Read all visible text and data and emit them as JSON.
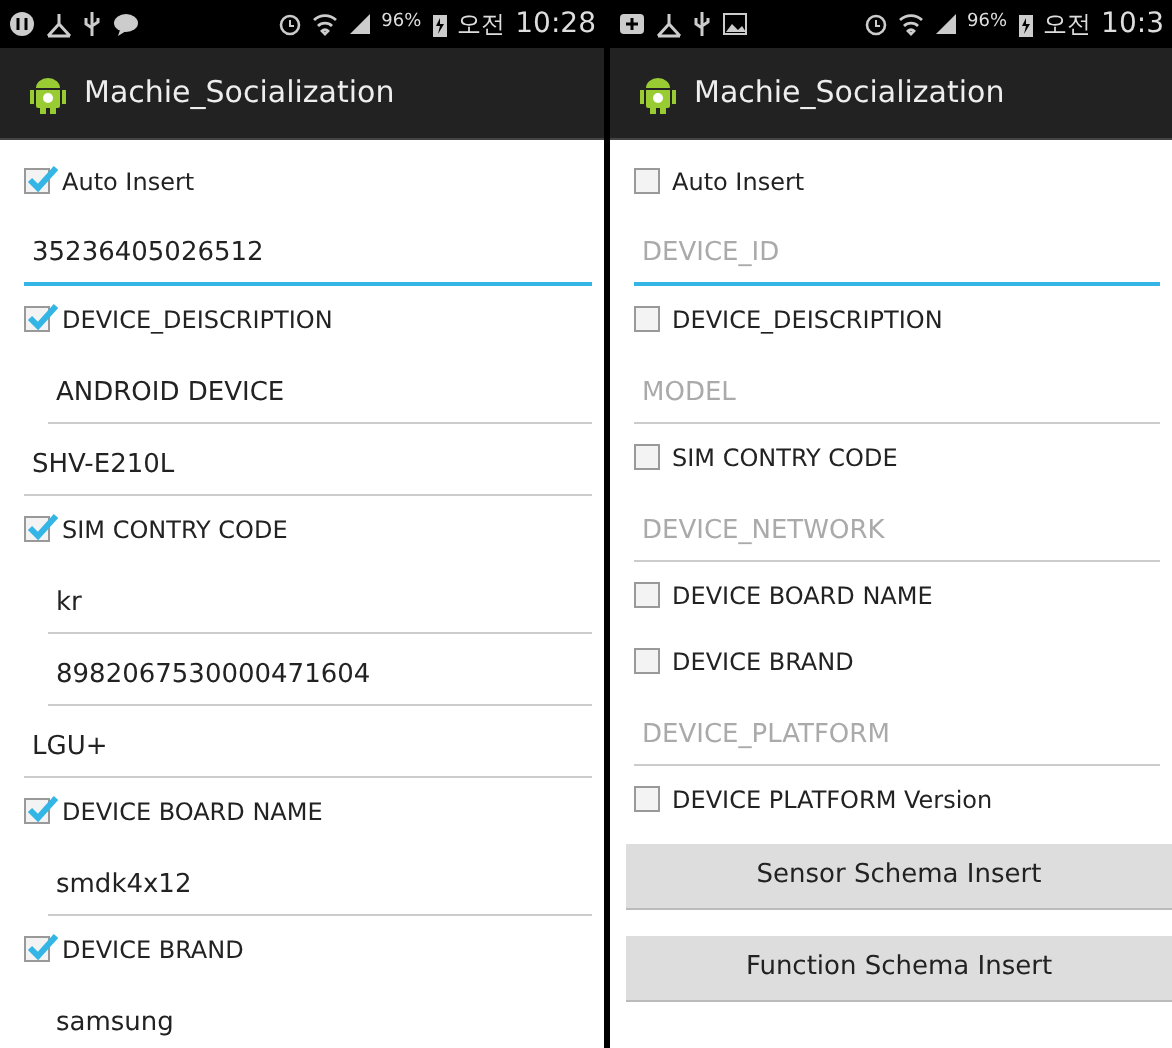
{
  "screens": [
    {
      "status_bar": {
        "battery": "96%",
        "ampm": "오전",
        "time": "10:28",
        "notifications": [
          {
            "kind": "logo"
          },
          {
            "kind": "hanger"
          },
          {
            "kind": "usb"
          },
          {
            "kind": "chat"
          }
        ]
      },
      "title": "Machie_Socialization",
      "items": [
        {
          "kind": "checkbox",
          "label": "Auto Insert",
          "checked": true
        },
        {
          "kind": "field",
          "value": "35236405026512",
          "focused": true,
          "indented": false
        },
        {
          "kind": "checkbox",
          "label": "DEVICE_DEISCRIPTION",
          "checked": true
        },
        {
          "kind": "field",
          "value": "ANDROID DEVICE",
          "focused": false,
          "indented": true
        },
        {
          "kind": "field",
          "value": "SHV-E210L",
          "focused": false,
          "indented": false
        },
        {
          "kind": "checkbox",
          "label": "SIM CONTRY CODE",
          "checked": true
        },
        {
          "kind": "field",
          "value": "kr",
          "focused": false,
          "indented": true
        },
        {
          "kind": "field",
          "value": "8982067530000471604",
          "focused": false,
          "indented": true
        },
        {
          "kind": "field",
          "value": "LGU+",
          "focused": false,
          "indented": false
        },
        {
          "kind": "checkbox",
          "label": "DEVICE BOARD NAME",
          "checked": true
        },
        {
          "kind": "field",
          "value": "smdk4x12",
          "focused": false,
          "indented": true
        },
        {
          "kind": "checkbox",
          "label": "DEVICE BRAND",
          "checked": true
        },
        {
          "kind": "field",
          "value": "samsung",
          "focused": false,
          "indented": true
        }
      ]
    },
    {
      "status_bar": {
        "battery": "96%",
        "ampm": "오전",
        "time": "10:3",
        "notifications": [
          {
            "kind": "badge"
          },
          {
            "kind": "hanger"
          },
          {
            "kind": "usb"
          },
          {
            "kind": "image"
          }
        ]
      },
      "title": "Machie_Socialization",
      "items": [
        {
          "kind": "checkbox",
          "label": "Auto Insert",
          "checked": false
        },
        {
          "kind": "field",
          "placeholder": "DEVICE_ID",
          "focused": true,
          "indented": false
        },
        {
          "kind": "checkbox",
          "label": "DEVICE_DEISCRIPTION",
          "checked": false
        },
        {
          "kind": "field",
          "placeholder": "MODEL",
          "focused": false,
          "indented": false
        },
        {
          "kind": "checkbox",
          "label": "SIM CONTRY CODE",
          "checked": false
        },
        {
          "kind": "field",
          "placeholder": "DEVICE_NETWORK",
          "focused": false,
          "indented": false
        },
        {
          "kind": "checkbox",
          "label": "DEVICE BOARD NAME",
          "checked": false
        },
        {
          "kind": "checkbox",
          "label": "DEVICE BRAND",
          "checked": false
        },
        {
          "kind": "field",
          "placeholder": "DEVICE_PLATFORM",
          "focused": false,
          "indented": false
        },
        {
          "kind": "checkbox",
          "label": "DEVICE PLATFORM Version",
          "checked": false
        },
        {
          "kind": "button",
          "label": "Sensor Schema Insert"
        },
        {
          "kind": "button",
          "label": "Function Schema Insert"
        }
      ]
    }
  ]
}
